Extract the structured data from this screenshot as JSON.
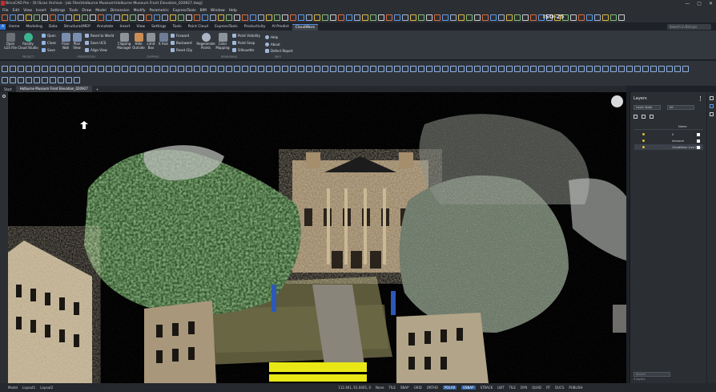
{
  "app": {
    "window_title": "BricsCAD Pro - [K:\\Scan Archive - Job Files\\Holburne Museum\\Holburne Museum Front Elevation_020927.dwg]",
    "window_controls": [
      "—",
      "▢",
      "✕"
    ]
  },
  "menu": [
    "File",
    "Edit",
    "View",
    "Insert",
    "Settings",
    "Tools",
    "Draw",
    "Model",
    "Dimension",
    "Modify",
    "Parametric",
    "ExpressTools",
    "BIM",
    "Window",
    "Help"
  ],
  "quick_access": {
    "annotation_scale": "ISO-25",
    "search_placeholder": "Search in Bricsys"
  },
  "ribbon_tabs": [
    "Home",
    "Modeling",
    "Data",
    "Structural/MEP",
    "Annotate",
    "Insert",
    "View",
    "Settings",
    "Tools",
    "Point Cloud",
    "ExpressTools",
    "Productivity",
    "AI Predict",
    "CloudWorx"
  ],
  "ribbon_active_tab": "CloudWorx",
  "ribbon": {
    "project": {
      "open_lgs": "Open LGS File",
      "reality_cloud": "Reality Cloud Studio",
      "open": "Open",
      "close": "Close",
      "save": "Save",
      "label": "PROJECT"
    },
    "orientation": {
      "floor_wall": "Floor Wall",
      "plan_view": "Plan View",
      "reset_world": "Reset to World",
      "save_ucs": "Save UCS",
      "align_view": "Align View",
      "label": "ORIENTATION"
    },
    "clipping": {
      "clipping_manager": "Clipping Manager",
      "hide_outside": "Hide Outside",
      "limit_box": "Limit Box",
      "x_axis": "X Axis",
      "forward": "Forward",
      "backward": "Backward",
      "reset_clip": "Reset Clip",
      "label": "CLIPPING"
    },
    "rendering": {
      "regenerate_points": "Regenerate Points",
      "color_mapping": "Color Mapping",
      "point_visibility": "Point Visibility",
      "point_snap": "Point Snap",
      "silhouette": "Silhouette",
      "label": "RENDERING"
    },
    "info": {
      "help": "Help",
      "about": "About",
      "defect_report": "Defect Report",
      "label": "INFO"
    }
  },
  "doc_tabs": [
    "Start",
    "Holburne Museum Front Elevation_020927",
    "+"
  ],
  "layers_panel": {
    "title": "Layers",
    "filter_dropdown": "Layer state",
    "all_dropdown": "All",
    "column_name": "Name",
    "layers": [
      {
        "name": "0",
        "color": "#ffffff"
      },
      {
        "name": "linework",
        "color": "#ffffff"
      },
      {
        "name": "CloudWorx Live Clip",
        "color": "#ffffff"
      }
    ],
    "footer": "3 layers",
    "footer_search": "Search"
  },
  "status_bar": {
    "layout_tabs": [
      "Model",
      "Layout1",
      "Layout2"
    ],
    "coords": "112.461, 61.0605, 0",
    "toggles": [
      "None",
      "TILE",
      "SNAP",
      "GRID",
      "ORTHO",
      "POLAR",
      "ESNAP",
      "STRACK",
      "LWT",
      "TILE",
      "DYN",
      "QUAD",
      "RT",
      "DUCS",
      "PUBLISH"
    ],
    "active_toggles": [
      "POLAR",
      "ESNAP"
    ]
  },
  "colors": {
    "ribbon_bg": "#33373e",
    "accent": "#2f5f9e",
    "highlight_yellow": "#e9e816"
  }
}
